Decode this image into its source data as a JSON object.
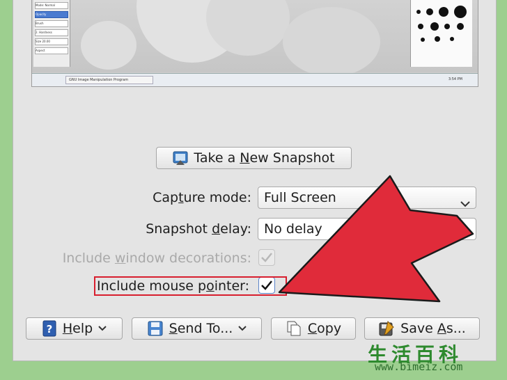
{
  "preview": {
    "tool_rows": [
      "Mode: Normal",
      "Opacity",
      "Brush",
      "2. Hardness",
      "Size 20.00",
      "Aspect"
    ],
    "taskbar_item": "GNU Image Manipulation Program",
    "taskbar_clock": "3:54 PM"
  },
  "snapshot_button": {
    "pre": "Take a ",
    "u": "N",
    "post": "ew Snapshot"
  },
  "form": {
    "capture_mode": {
      "pre": "Cap",
      "u": "t",
      "post": "ure mode:",
      "value": "Full Screen"
    },
    "snapshot_delay": {
      "pre": "Snapshot ",
      "u": "d",
      "post": "elay:",
      "value": "No delay"
    },
    "window_decorations": {
      "pre": "Include ",
      "u": "w",
      "post": "indow decorations:",
      "checked": true,
      "disabled": true
    },
    "mouse_pointer": {
      "pre": "Include mouse p",
      "u": "o",
      "post": "inter:",
      "checked": true
    }
  },
  "buttons": {
    "help": {
      "u": "H",
      "post": "elp"
    },
    "send_to": {
      "u": "S",
      "post": "end To..."
    },
    "copy": {
      "u": "C",
      "post": "opy"
    },
    "save_as": {
      "pre": "Save ",
      "u": "A",
      "post": "s..."
    }
  },
  "colors": {
    "arrow_red": "#e02b3a",
    "highlight_red": "#d81e2e",
    "background_green": "#9dcf8f"
  },
  "watermark": {
    "cn": "生活百科",
    "url": "www.bimeiz.com"
  }
}
